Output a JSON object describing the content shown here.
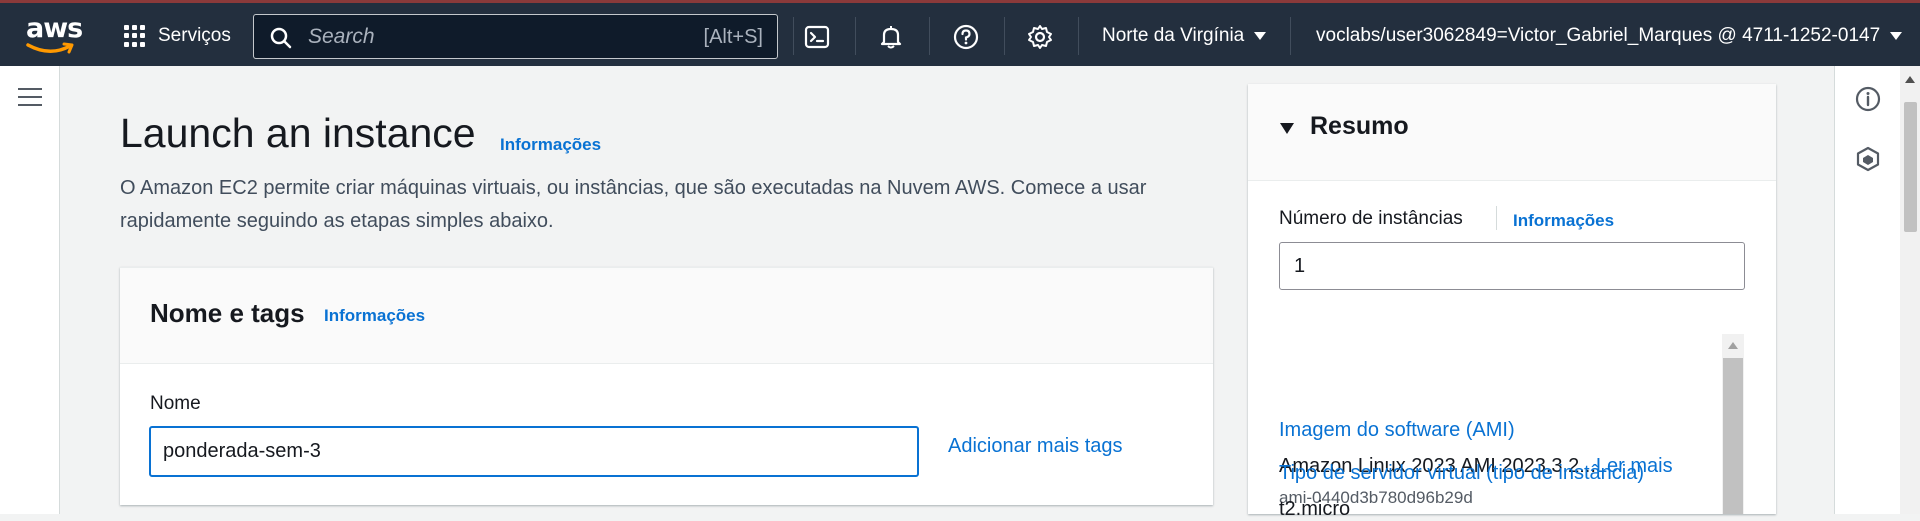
{
  "topnav": {
    "logo_text": "aws",
    "services_label": "Serviços",
    "search_placeholder": "Search",
    "search_shortcut": "[Alt+S]",
    "icons": [
      "cloudshell-icon",
      "notifications-bell-icon",
      "help-icon",
      "settings-gear-icon"
    ],
    "region_label": "Norte da Virgínia",
    "account_label": "voclabs/user3062849=Victor_Gabriel_Marques @ 4711-1252-0147"
  },
  "main": {
    "title": "Launch an instance",
    "title_info": "Informações",
    "description": "O Amazon EC2 permite criar máquinas virtuais, ou instâncias, que são executadas na Nuvem AWS. Comece a usar rapidamente seguindo as etapas simples abaixo.",
    "name_tags_panel": {
      "title": "Nome e tags",
      "info": "Informações",
      "name_label": "Nome",
      "name_value": "ponderada-sem-3",
      "add_tags_label": "Adicionar mais tags"
    }
  },
  "summary": {
    "title": "Resumo",
    "instances_label": "Número de instâncias",
    "instances_info": "Informações",
    "instances_value": "1",
    "ami_label": "Imagem do software (AMI)",
    "ami_value": "Amazon Linux 2023 AMI 2023.3.2...",
    "ami_more": "Ler mais",
    "ami_id": "ami-0440d3b780d96b29d",
    "instance_type_label": "Tipo de servidor virtual (tipo de instância)",
    "instance_type_value": "t2.micro"
  },
  "colors": {
    "nav_bg": "#232f3e",
    "link": "#0972d3",
    "focus_border": "#0972d3"
  }
}
